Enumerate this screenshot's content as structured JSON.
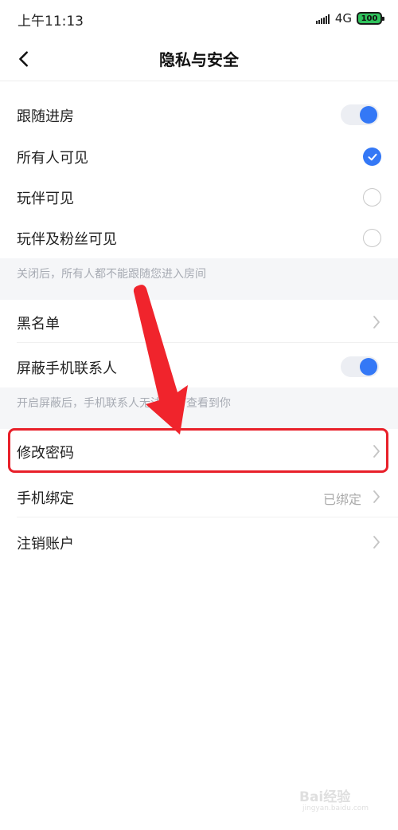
{
  "status_bar": {
    "time": "上午11:13",
    "network": "4G",
    "battery": "100"
  },
  "nav": {
    "title": "隐私与安全"
  },
  "follow_section": {
    "follow_room": {
      "label": "跟随进房",
      "enabled": true
    },
    "visibility_options": [
      {
        "label": "所有人可见",
        "selected": true
      },
      {
        "label": "玩伴可见",
        "selected": false
      },
      {
        "label": "玩伴及粉丝可见",
        "selected": false
      }
    ],
    "hint": "关闭后，所有人都不能跟随您进入房间"
  },
  "contacts_section": {
    "blacklist": {
      "label": "黑名单"
    },
    "block_contacts": {
      "label": "屏蔽手机联系人",
      "enabled": true
    },
    "hint": "开启屏蔽后，手机联系人无法在TT查看到你"
  },
  "account_section": {
    "change_password": {
      "label": "修改密码"
    },
    "phone_binding": {
      "label": "手机绑定",
      "value": "已绑定"
    },
    "delete_account": {
      "label": "注销账户"
    }
  },
  "watermark": {
    "logo": "Bai经验",
    "url": "jingyan.baidu.com"
  },
  "colors": {
    "accent": "#3478f6",
    "annotation": "#e8202a",
    "section_bg": "#f5f6f8"
  }
}
